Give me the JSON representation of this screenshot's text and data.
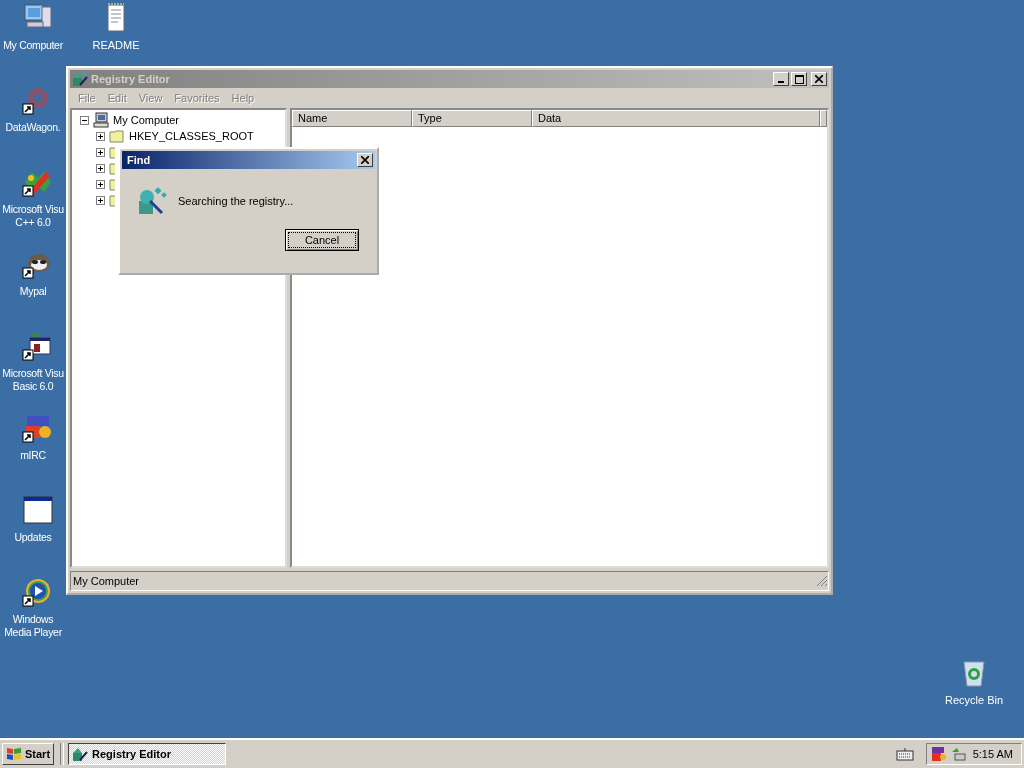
{
  "desktop": {
    "column": [
      {
        "label": "My Computer",
        "kind": "computer",
        "shortcut": false
      },
      {
        "label": "DataWagon.",
        "kind": "datawagon",
        "shortcut": true
      },
      {
        "label": "Microsoft Visu C++ 6.0",
        "kind": "vcpp",
        "shortcut": true
      },
      {
        "label": "Mypal",
        "kind": "mypal",
        "shortcut": true
      },
      {
        "label": "Microsoft Visu Basic 6.0",
        "kind": "vb",
        "shortcut": true
      },
      {
        "label": "mIRC",
        "kind": "mirc",
        "shortcut": true
      },
      {
        "label": "Updates",
        "kind": "window",
        "shortcut": false
      },
      {
        "label": "Windows Media Player",
        "kind": "media",
        "shortcut": true
      }
    ],
    "readme": {
      "label": "README",
      "kind": "document"
    },
    "recycle_bin": {
      "label": "Recycle Bin",
      "kind": "recycle"
    }
  },
  "window": {
    "title": "Registry Editor",
    "active": false,
    "menu": [
      {
        "label": "File",
        "disabled": true
      },
      {
        "label": "Edit",
        "disabled": true
      },
      {
        "label": "View",
        "disabled": true
      },
      {
        "label": "Favorites",
        "disabled": true
      },
      {
        "label": "Help",
        "disabled": true
      }
    ],
    "tree": {
      "label": "My Computer",
      "expanded": true,
      "children": [
        {
          "label": "HKEY_CLASSES_ROOT",
          "expanded": false
        },
        {
          "expanded": false
        },
        {
          "expanded": false
        },
        {
          "expanded": false
        },
        {
          "expanded": false
        }
      ]
    },
    "columns": [
      "Name",
      "Type",
      "Data"
    ],
    "status_bar": "My Computer"
  },
  "dialog": {
    "title": "Find",
    "message": "Searching the registry...",
    "button": "Cancel"
  },
  "taskbar": {
    "start": "Start",
    "tasks": [
      {
        "label": "Registry Editor",
        "pressed": true
      }
    ],
    "clock": "5:15 AM"
  }
}
